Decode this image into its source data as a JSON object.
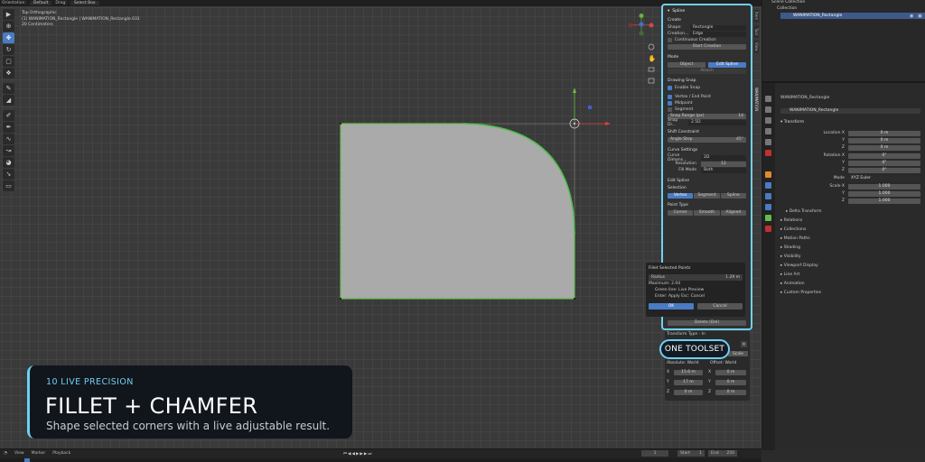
{
  "topbar": {
    "orientation_label": "Orientation:",
    "orientation_value": "Default",
    "drag_label": "Drag:",
    "drag_value": "Select Box"
  },
  "viewport": {
    "view_name": "Top Orthographic",
    "object_info": "(1) WANIMATION_Rectangle | WANIMATION_Rectangle.031",
    "scale_info": "20 Centimeters"
  },
  "npanel": {
    "header": "Spline",
    "create_title": "Create",
    "shape_label": "Shape:",
    "shape_value": "Rectangle",
    "creation_label": "Creation...",
    "creation_value": "Edge",
    "continuous_label": "Continuous Creation",
    "start_creation": "Start Creation",
    "mode_title": "Mode",
    "mode_object": "Object",
    "mode_edit": "Edit Spline",
    "attach_label": "Attach",
    "drawing_snap_title": "Drawing Snap",
    "enable_snap": "Enable Snap",
    "vertex_end": "Vertex / End Point",
    "midpoint": "Midpoint",
    "segment": "Segment",
    "snap_range_label": "Snap Range (px)",
    "snap_range_value": "14",
    "snap_di_label": "Snap Di...",
    "snap_di_value": "2.5D",
    "shift_constraint_title": "Shift Constraint",
    "angle_step_label": "Angle Step",
    "angle_step_value": "45°",
    "curve_settings_title": "Curve Settings",
    "curve_dim_label": "Curve Dimens...",
    "curve_dim_value": "2D",
    "resolution_label": "Resolution",
    "resolution_value": "12",
    "fill_mode_label": "Fill Mode",
    "fill_mode_value": "Both",
    "edit_spline_title": "Edit Spline",
    "selection_title": "Selection",
    "sel_vertex": "Vertex",
    "sel_segment": "Segment",
    "sel_spline": "Spline",
    "point_type_title": "Point Type",
    "pt_corner": "Corner",
    "pt_smooth": "Smooth",
    "pt_aligned": "Aligned",
    "delete_label": "Delete (Del)"
  },
  "fillet": {
    "title": "Fillet Selected Points",
    "radius_label": "Radius",
    "radius_value": "1.29 m",
    "maximum": "Maximum: 2.04",
    "green_line": "Green line: Live Preview",
    "enter_apply": "Enter: Apply   Esc: Cancel",
    "ok": "OK",
    "cancel": "Cancel"
  },
  "transform_popup": {
    "header": "Transform Type - In",
    "scale": "Scale",
    "absolute_label": "Absolute: World",
    "offset_label": "Offset: World",
    "abs_x": "15.6 m",
    "abs_y": "17 m",
    "abs_z": "0 m",
    "off_x": "0 m",
    "off_y": "0 m",
    "off_z": "0 m"
  },
  "toolset_badge": "ONE TOOLSET",
  "outliner": {
    "scene_collection": "Scene Collection",
    "collection": "Collection",
    "object": "WANIMATION_Rectangle"
  },
  "properties": {
    "object_name": "WANIMATION_Rectangle",
    "object_field": "WANIMATION_Rectangle",
    "transform_title": "Transform",
    "location_label": "Location X",
    "rotation_label": "Rotation X",
    "mode_label": "Mode",
    "mode_value": "XYZ Euler",
    "scale_label": "Scale X",
    "loc": [
      "0 m",
      "0 m",
      "0 m"
    ],
    "rot": [
      "0°",
      "0°",
      "0°"
    ],
    "scl": [
      "1.000",
      "1.000",
      "1.000"
    ],
    "sections": [
      "Delta Transform",
      "Relations",
      "Collections",
      "Motion Paths",
      "Shading",
      "Visibility",
      "Viewport Display",
      "Line Art",
      "Animation",
      "Custom Properties"
    ]
  },
  "timeline": {
    "view": "View",
    "marker": "Marker",
    "playback": "Playback",
    "current_frame": "1",
    "start_label": "Start",
    "start_value": "1",
    "end_label": "End",
    "end_value": "250"
  },
  "lower_third": {
    "kicker": "10  LIVE PRECISION",
    "title": "FILLET + CHAMFER",
    "subtitle": "Shape selected corners with a live adjustable result."
  },
  "colors": {
    "accent": "#6fd0f0",
    "selection_blue": "#4a7bc4",
    "shape_fill": "#aaaaaa",
    "curve_green": "#5fbf4a"
  }
}
